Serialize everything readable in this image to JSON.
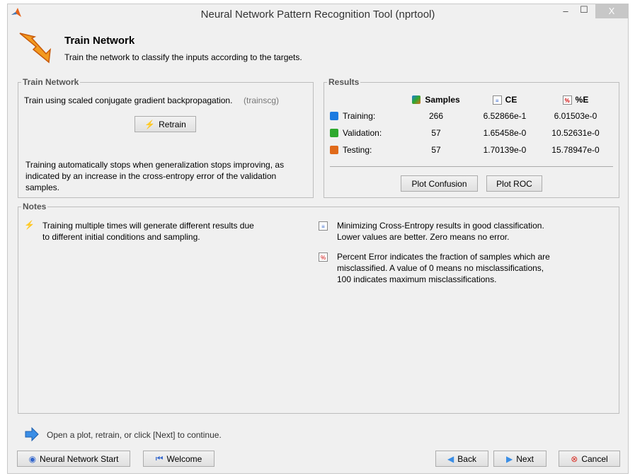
{
  "window": {
    "title": "Neural Network Pattern Recognition Tool (nprtool)",
    "minimize": "‒",
    "maximize": "☐",
    "close": "X"
  },
  "header": {
    "title": "Train Network",
    "subtitle": "Train the network to classify the inputs according to the targets."
  },
  "train": {
    "group_label": "Train Network",
    "description": "Train using scaled conjugate gradient backpropagation.",
    "algorithm": "(trainscg)",
    "retrain_label": "Retrain",
    "note": "Training automatically stops when generalization stops improving, as indicated by an increase in the cross-entropy error of the validation samples."
  },
  "results": {
    "group_label": "Results",
    "headers": [
      "Samples",
      "CE",
      "%E"
    ],
    "rows": [
      {
        "label": "Training:",
        "samples": "266",
        "ce": "6.52866e-1",
        "pe": "6.01503e-0",
        "color": "#1e7be0"
      },
      {
        "label": "Validation:",
        "samples": "57",
        "ce": "1.65458e-0",
        "pe": "10.52631e-0",
        "color": "#2ea82e"
      },
      {
        "label": "Testing:",
        "samples": "57",
        "ce": "1.70139e-0",
        "pe": "15.78947e-0",
        "color": "#e06a1a"
      }
    ],
    "plot_confusion": "Plot Confusion",
    "plot_roc": "Plot ROC"
  },
  "notes": {
    "group_label": "Notes",
    "left": "Training multiple times will generate different results due to different initial conditions and sampling.",
    "ce": "Minimizing Cross-Entropy results in good classification. Lower values are better. Zero means no error.",
    "pe": "Percent Error  indicates the fraction of samples which are misclassified. A value of 0 means no misclassifications, 100 indicates maximum misclassifications.",
    "pe_icon_text": "%"
  },
  "footer": {
    "hint": "Open a plot, retrain, or click [Next] to continue.",
    "nn_start": "Neural Network Start",
    "welcome": "Welcome",
    "back": "Back",
    "next": "Next",
    "cancel": "Cancel"
  }
}
